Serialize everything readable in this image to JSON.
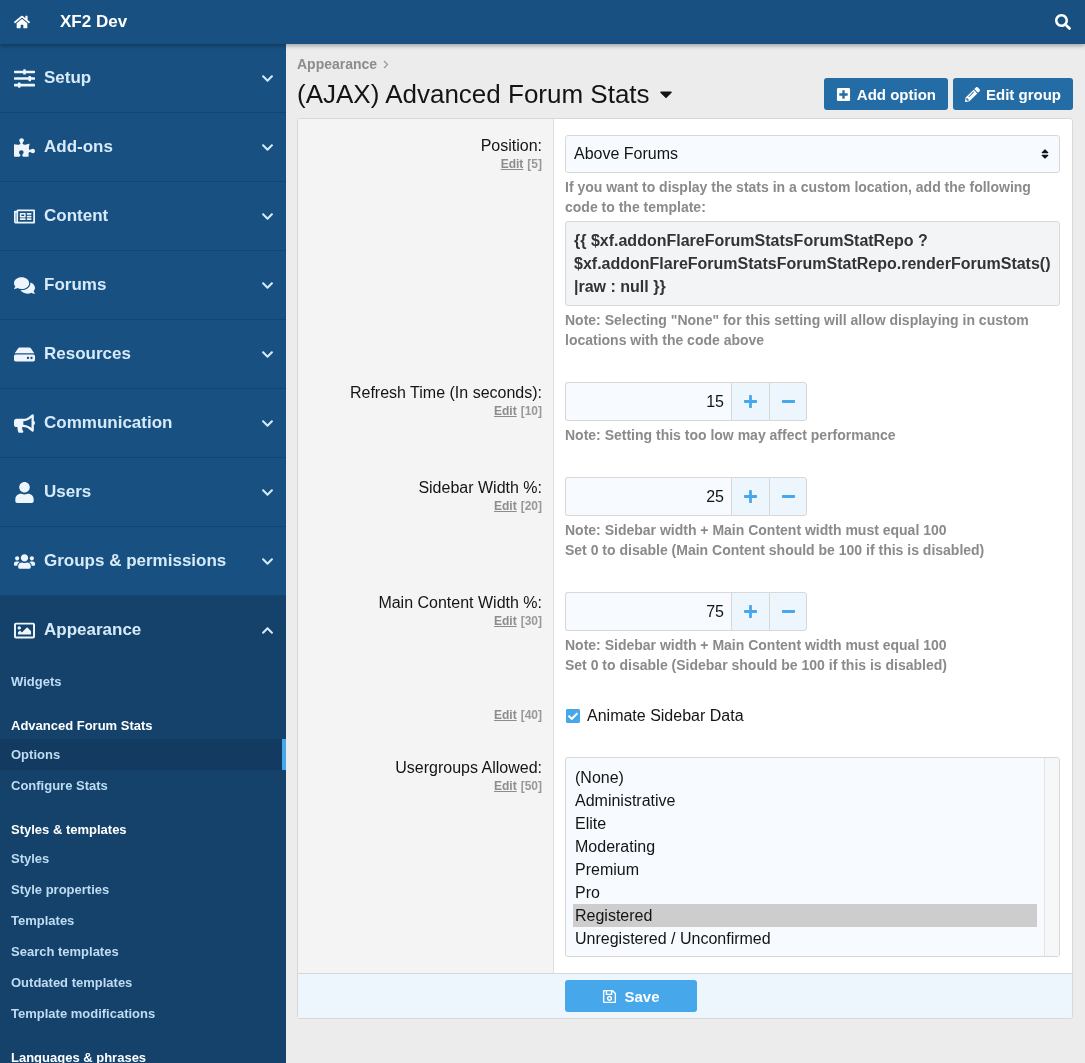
{
  "header": {
    "title": "XF2 Dev"
  },
  "sidebar": {
    "sections": [
      {
        "label": "Setup",
        "expanded": false
      },
      {
        "label": "Add-ons",
        "expanded": false
      },
      {
        "label": "Content",
        "expanded": false
      },
      {
        "label": "Forums",
        "expanded": false
      },
      {
        "label": "Resources",
        "expanded": false
      },
      {
        "label": "Communication",
        "expanded": false
      },
      {
        "label": "Users",
        "expanded": false
      },
      {
        "label": "Groups & permissions",
        "expanded": false
      },
      {
        "label": "Appearance",
        "expanded": true,
        "groups": [
          {
            "links": [
              {
                "label": "Widgets",
                "selected": false
              }
            ]
          },
          {
            "heading": "Advanced Forum Stats",
            "links": [
              {
                "label": "Options",
                "selected": true
              },
              {
                "label": "Configure Stats",
                "selected": false
              }
            ]
          },
          {
            "heading": "Styles & templates",
            "links": [
              {
                "label": "Styles",
                "selected": false
              },
              {
                "label": "Style properties",
                "selected": false
              },
              {
                "label": "Templates",
                "selected": false
              },
              {
                "label": "Search templates",
                "selected": false
              },
              {
                "label": "Outdated templates",
                "selected": false
              },
              {
                "label": "Template modifications",
                "selected": false
              }
            ]
          },
          {
            "heading": "Languages & phrases"
          }
        ]
      }
    ]
  },
  "breadcrumb": [
    "Appearance"
  ],
  "page": {
    "title": "(AJAX) Advanced Forum Stats",
    "actions": [
      "Add option",
      "Edit group"
    ]
  },
  "options": [
    {
      "kind": "select",
      "label": "Position:",
      "edit": "Edit",
      "order": "[5]",
      "value": "Above Forums",
      "hints": [
        "If you want to display the stats in a custom location, add the following code to the template:"
      ],
      "code": "{{ $xf.addonFlareForumStatsForumStatRepo ? $xf.addonFlareForumStatsForumStatRepo.renderForumStats()|raw : null }}",
      "notes": [
        "Note: Selecting \"None\" for this setting will allow displaying in custom locations with the code above"
      ]
    },
    {
      "kind": "spinbox",
      "label": "Refresh Time (In seconds):",
      "edit": "Edit",
      "order": "[10]",
      "value": "15",
      "notes": [
        "Note: Setting this too low may affect performance"
      ]
    },
    {
      "kind": "spinbox",
      "label": "Sidebar Width %:",
      "edit": "Edit",
      "order": "[20]",
      "value": "25",
      "notes": [
        "Note: Sidebar width + Main Content width must equal 100",
        "Set 0 to disable (Main Content should be 100 if this is disabled)"
      ]
    },
    {
      "kind": "spinbox",
      "label": "Main Content Width %:",
      "edit": "Edit",
      "order": "[30]",
      "value": "75",
      "notes": [
        "Note: Sidebar width + Main Content width must equal 100",
        "Set 0 to disable (Sidebar should be 100 if this is disabled)"
      ]
    },
    {
      "kind": "checkbox",
      "edit": "Edit",
      "order": "[40]",
      "value": "Animate Sidebar Data",
      "checked": true
    },
    {
      "kind": "listbox",
      "label": "Usergroups Allowed:",
      "edit": "Edit",
      "order": "[50]",
      "items": [
        {
          "label": "(None)",
          "selected": false
        },
        {
          "label": "Administrative",
          "selected": false
        },
        {
          "label": "Elite",
          "selected": false
        },
        {
          "label": "Moderating",
          "selected": false
        },
        {
          "label": "Premium",
          "selected": false
        },
        {
          "label": "Pro",
          "selected": false
        },
        {
          "label": "Registered",
          "selected": true
        },
        {
          "label": "Unregistered / Unconfirmed",
          "selected": false
        }
      ]
    }
  ],
  "save": "Save"
}
